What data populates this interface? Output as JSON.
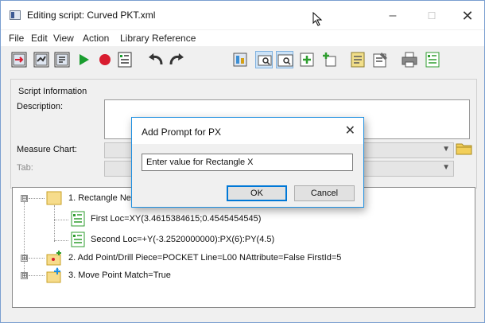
{
  "window": {
    "title": "Editing script: Curved PKT.xml",
    "controls": {
      "minimize": "–",
      "maximize": "☐",
      "close": "✕"
    }
  },
  "menu": [
    "File",
    "Edit",
    "View",
    "Action",
    "Library Reference"
  ],
  "toolbar": {
    "icons": [
      "import-script-icon",
      "export-script-icon",
      "properties-icon",
      "play-icon",
      "record-icon",
      "script-list-icon",
      "undo-icon",
      "redo-icon",
      "chart-icon",
      "zoom-window-icon",
      "zoom-fit-icon",
      "add-icon",
      "add-multiple-icon",
      "notes-icon",
      "edit-notes-icon",
      "print-icon",
      "report-icon"
    ],
    "active": [
      "zoom-window-icon",
      "zoom-fit-icon"
    ]
  },
  "script_info": {
    "legend": "Script Information",
    "description_label": "Description:",
    "measure_chart_label": "Measure Chart:",
    "tab_label": "Tab:"
  },
  "tree": {
    "items": [
      {
        "label": "1. Rectangle  Ne",
        "expander": "⊟"
      },
      {
        "label": "First  Loc=XY(3.4615384615;0.4545454545)"
      },
      {
        "label": "Second  Loc=+Y(-3.2520000000):PX(6):PY(4.5)"
      },
      {
        "label": "2. Add Point/Drill  Piece=POCKET  Line=L00  NAttribute=False  FirstId=5",
        "expander": "⊞"
      },
      {
        "label": "3. Move Point  Match=True",
        "expander": "⊞"
      }
    ]
  },
  "dialog": {
    "title": "Add Prompt for PX",
    "close": "✕",
    "input_value": "Enter value for Rectangle X",
    "ok": "OK",
    "cancel": "Cancel"
  },
  "colors": {
    "accent": "#1e8fe0",
    "play": "#1a9d2f",
    "record": "#d81c2f",
    "undo": "#333333",
    "add": "#2f9e2f"
  }
}
